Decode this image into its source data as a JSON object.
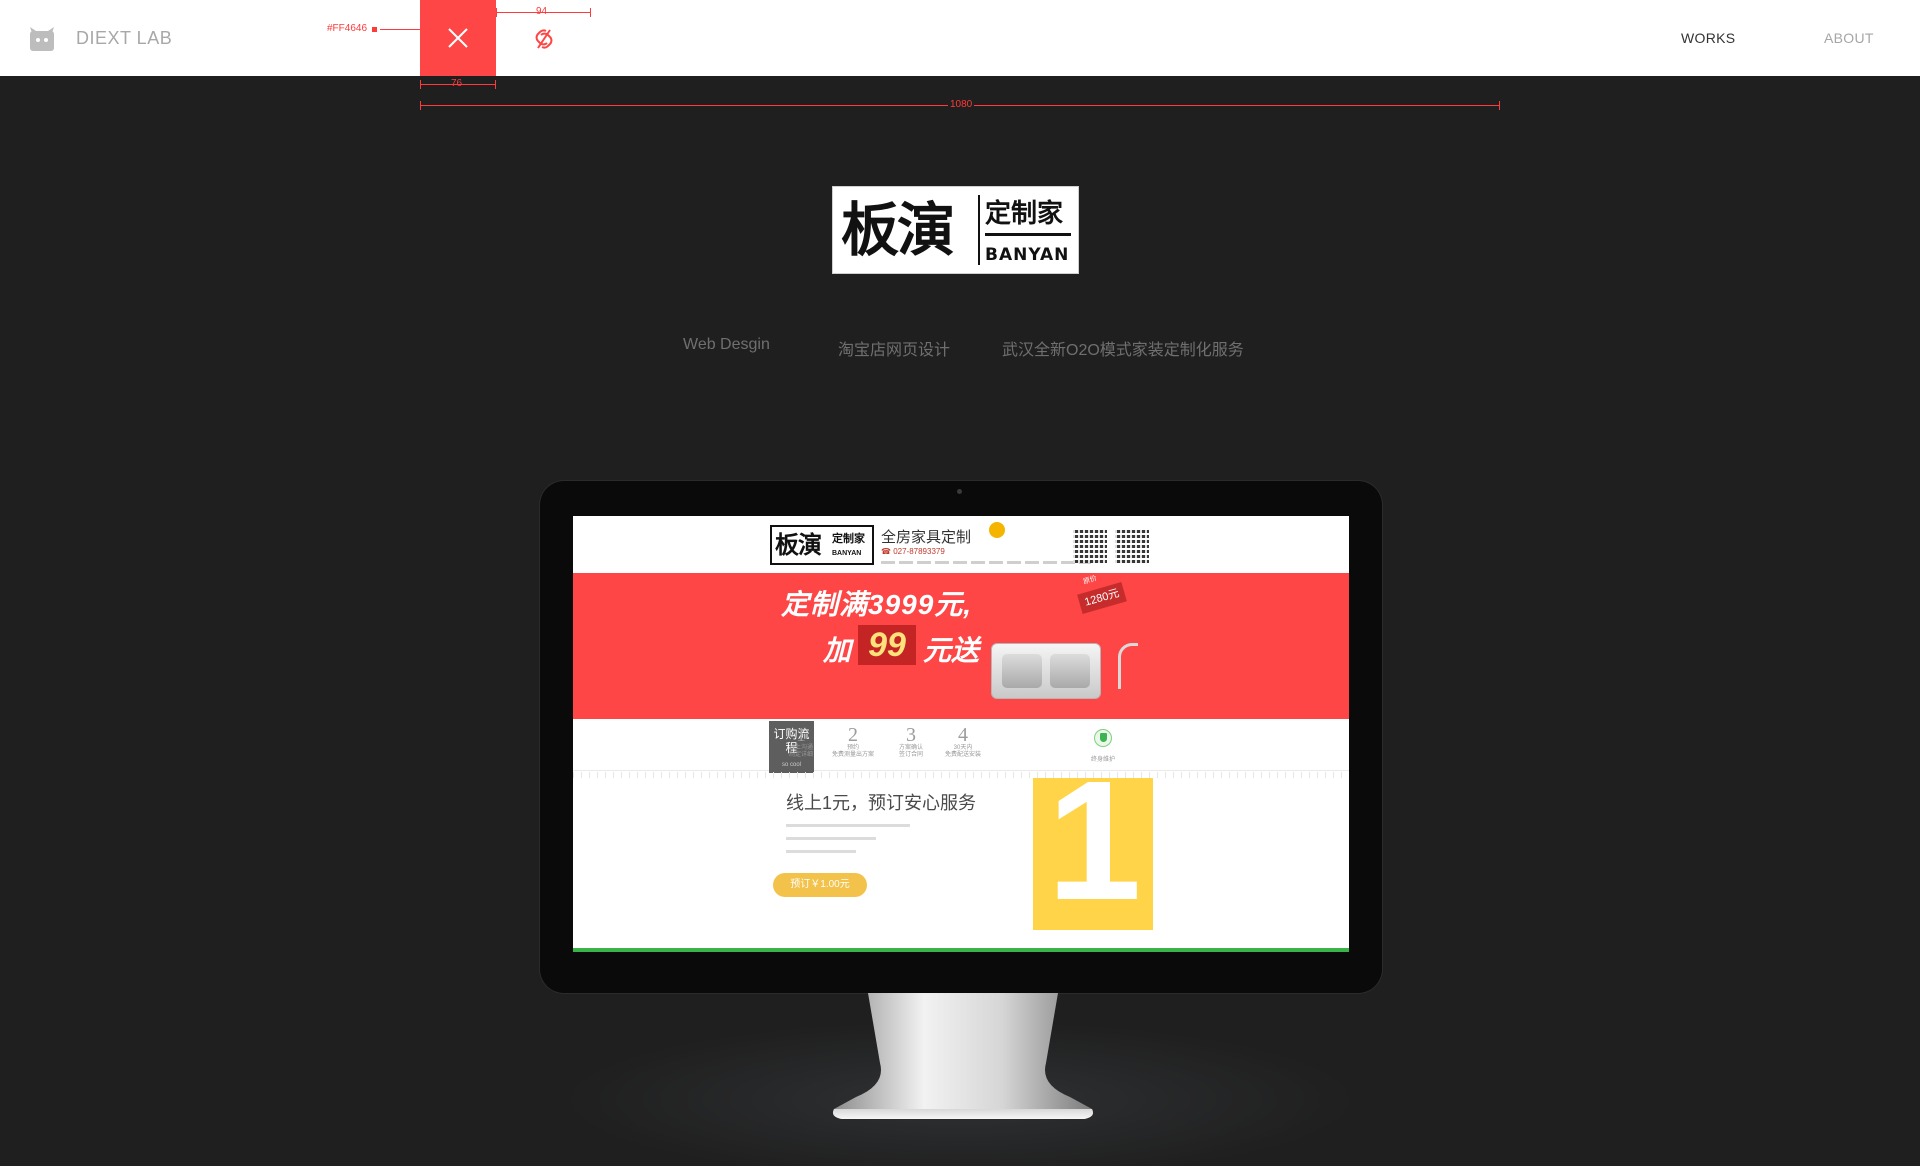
{
  "topbar": {
    "brand_name": "DIEXT LAB",
    "nav": {
      "works": "WORKS",
      "about": "ABOUT"
    },
    "close_color": "#FF4646"
  },
  "annotations": {
    "color_label": "#FF4646",
    "width_94": "94",
    "width_76": "76",
    "width_1080": "1080"
  },
  "project": {
    "logo": {
      "main": "板演",
      "side": "定制家",
      "latin": "BANYAN"
    },
    "tags": [
      "Web Desgin",
      "淘宝店网页设计",
      "武汉全新O2O模式家装定制化服务"
    ]
  },
  "screen": {
    "header": {
      "slogan": "全房家具定制",
      "phone": "☎ 027-87893379"
    },
    "banner": {
      "line1": "定制满3999元,",
      "line2_pre": "加",
      "line2_num": "99",
      "line2_post": "元送",
      "price_tag": "1280元",
      "price_small": "原价"
    },
    "steps": {
      "head": "订购流程",
      "head_sub": "so cool",
      "items": [
        {
          "num": "1",
          "text1": "线上沟通",
          "text2": "制定详细"
        },
        {
          "num": "2",
          "text1": "预约",
          "text2": "免费测量出方案"
        },
        {
          "num": "3",
          "text1": "方案确认",
          "text2": "签订合同"
        },
        {
          "num": "4",
          "text1": "30天内",
          "text2": "免费配送安装"
        }
      ],
      "guarantee": "终身维护"
    },
    "main": {
      "title": "线上1元，预订安心服务",
      "cta": "预订￥1.00元",
      "big_number": "1"
    }
  }
}
